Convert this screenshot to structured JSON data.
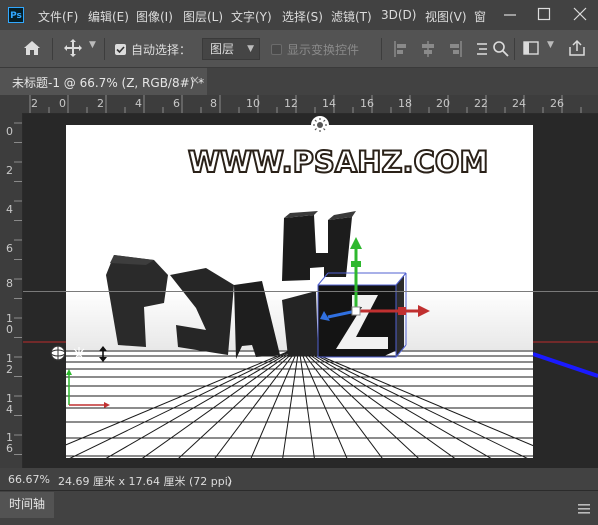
{
  "app": {
    "logo": "Ps"
  },
  "menubar": {
    "items": [
      "文件(F)",
      "编辑(E)",
      "图像(I)",
      "图层(L)",
      "文字(Y)",
      "选择(S)",
      "滤镜(T)",
      "3D(D)",
      "视图(V)",
      "窗"
    ],
    "window_controls": [
      "minimize-icon",
      "maximize-icon",
      "close-icon"
    ]
  },
  "options": {
    "home_icon": "home-icon",
    "move_icon": "move-tool-icon",
    "auto_select_label": "自动选择：",
    "auto_select_checked": true,
    "layer_dropdown": "图层",
    "show_transform_label": "显示变换控件",
    "show_transform_checked": false
  },
  "document": {
    "tab_title": "未标题-1 @ 66.7% (Z, RGB/8#) *",
    "close_glyph": "×"
  },
  "rulers": {
    "top": [
      "2",
      "0",
      "2",
      "4",
      "6",
      "8",
      "10",
      "12",
      "14",
      "16",
      "18",
      "20",
      "22",
      "24",
      "26"
    ],
    "left": [
      "0",
      "2",
      "4",
      "6",
      "8",
      "1\n0",
      "1\n2",
      "1\n4",
      "1\n6"
    ]
  },
  "canvas": {
    "watermark": "WWW.PSAHZ.COM",
    "scene_letters": [
      "P",
      "S",
      "A",
      "H",
      "Z"
    ],
    "light_icon": "light-sun-icon"
  },
  "status": {
    "zoom": "66.67%",
    "doc_size": "24.69 厘米 x 17.64 厘米 (72 ppi)",
    "arrow": "〉"
  },
  "panel": {
    "timeline_tab": "时间轴",
    "menu_icon": "panel-menu-icon"
  },
  "colors": {
    "menubar_bg": "#424242",
    "panel_bg": "#535353",
    "workspace_bg": "#282828",
    "accent_blue": "#31a8ff"
  }
}
